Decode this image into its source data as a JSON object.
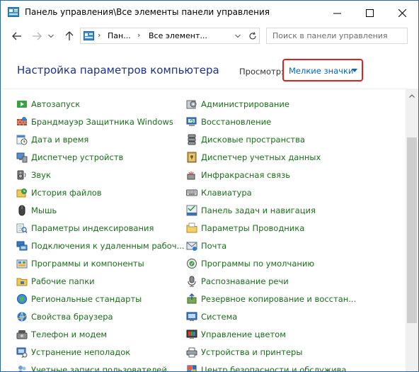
{
  "window": {
    "title": "Панель управления\\Все элементы панели управления"
  },
  "nav": {
    "breadcrumb": [
      "Пан...",
      "Все элемент..."
    ],
    "search_placeholder": "Поиск в панели управления"
  },
  "header": {
    "title": "Настройка параметров компьютера",
    "view_label": "Просмотр:",
    "view_value": "Мелкие значки"
  },
  "items_left": [
    {
      "label": "Автозапуск",
      "icon": "autoplay-icon"
    },
    {
      "label": "Брандмауэр Защитника Windows",
      "icon": "firewall-icon"
    },
    {
      "label": "Дата и время",
      "icon": "datetime-icon"
    },
    {
      "label": "Диспетчер устройств",
      "icon": "device-manager-icon"
    },
    {
      "label": "Звук",
      "icon": "sound-icon"
    },
    {
      "label": "История файлов",
      "icon": "file-history-icon"
    },
    {
      "label": "Мышь",
      "icon": "mouse-icon"
    },
    {
      "label": "Параметры индексирования",
      "icon": "indexing-icon"
    },
    {
      "label": "Подключения к удаленным рабоч...",
      "icon": "remote-connections-icon"
    },
    {
      "label": "Программы и компоненты",
      "icon": "programs-icon"
    },
    {
      "label": "Рабочие папки",
      "icon": "work-folders-icon"
    },
    {
      "label": "Региональные стандарты",
      "icon": "region-icon"
    },
    {
      "label": "Свойства браузера",
      "icon": "browser-properties-icon"
    },
    {
      "label": "Телефон и модем",
      "icon": "phone-modem-icon"
    },
    {
      "label": "Устранение неполадок",
      "icon": "troubleshooting-icon"
    },
    {
      "label": "Учетные записи пользователей",
      "icon": "user-accounts-icon"
    }
  ],
  "items_right": [
    {
      "label": "Администрирование",
      "icon": "admin-tools-icon"
    },
    {
      "label": "Восстановление",
      "icon": "recovery-icon"
    },
    {
      "label": "Дисковые пространства",
      "icon": "storage-spaces-icon"
    },
    {
      "label": "Диспетчер учетных данных",
      "icon": "credential-manager-icon"
    },
    {
      "label": "Инфракрасная связь",
      "icon": "infrared-icon"
    },
    {
      "label": "Клавиатура",
      "icon": "keyboard-icon"
    },
    {
      "label": "Панель задач и навигация",
      "icon": "taskbar-icon"
    },
    {
      "label": "Параметры Проводника",
      "icon": "explorer-options-icon"
    },
    {
      "label": "Почта",
      "icon": "mail-icon"
    },
    {
      "label": "Программы по умолчанию",
      "icon": "default-programs-icon"
    },
    {
      "label": "Распознавание речи",
      "icon": "speech-icon"
    },
    {
      "label": "Резервное копирование и восстан...",
      "icon": "backup-icon"
    },
    {
      "label": "Система",
      "icon": "system-icon"
    },
    {
      "label": "Управление цветом",
      "icon": "color-management-icon"
    },
    {
      "label": "Устройства и принтеры",
      "icon": "devices-printers-icon"
    },
    {
      "label": "Центр безопасности и обслужива...",
      "icon": "security-center-icon"
    }
  ]
}
